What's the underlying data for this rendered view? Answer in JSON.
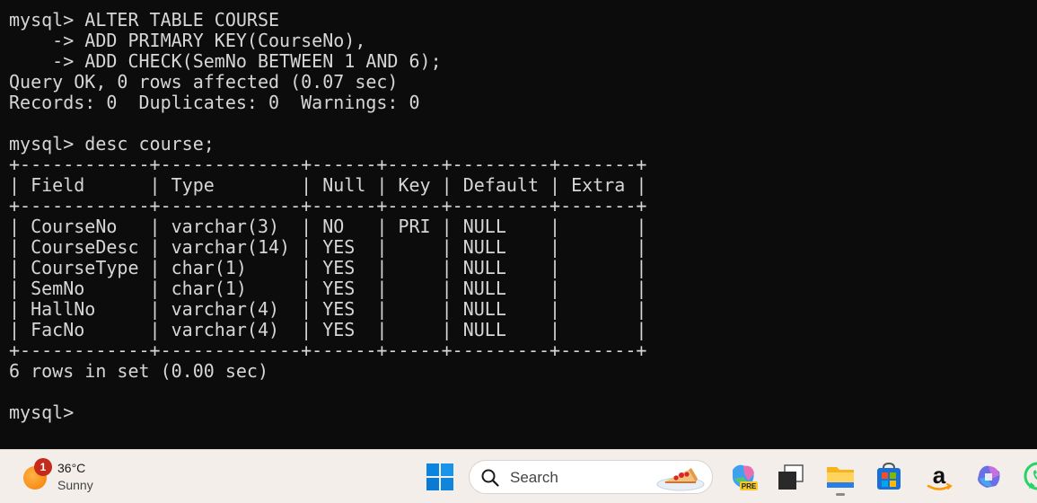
{
  "terminal": {
    "lines": [
      "mysql> ALTER TABLE COURSE",
      "    -> ADD PRIMARY KEY(CourseNo),",
      "    -> ADD CHECK(SemNo BETWEEN 1 AND 6);",
      "Query OK, 0 rows affected (0.07 sec)",
      "Records: 0  Duplicates: 0  Warnings: 0",
      "",
      "mysql> desc course;",
      "+------------+-------------+------+-----+---------+-------+",
      "| Field      | Type        | Null | Key | Default | Extra |",
      "+------------+-------------+------+-----+---------+-------+",
      "| CourseNo   | varchar(3)  | NO   | PRI | NULL    |       |",
      "| CourseDesc | varchar(14) | YES  |     | NULL    |       |",
      "| CourseType | char(1)     | YES  |     | NULL    |       |",
      "| SemNo      | char(1)     | YES  |     | NULL    |       |",
      "| HallNo     | varchar(4)  | YES  |     | NULL    |       |",
      "| FacNo      | varchar(4)  | YES  |     | NULL    |       |",
      "+------------+-------------+------+-----+---------+-------+",
      "6 rows in set (0.00 sec)",
      "",
      "mysql>"
    ]
  },
  "taskbar": {
    "weather": {
      "badge": "1",
      "temperature": "36°C",
      "condition": "Sunny",
      "icon": "weather-sun-icon"
    },
    "start_icon": "windows-start-icon",
    "search": {
      "placeholder": "Search"
    },
    "apps": [
      {
        "name": "copilot-pre-icon",
        "label": "PRE"
      },
      {
        "name": "task-view-icon"
      },
      {
        "name": "file-explorer-icon"
      },
      {
        "name": "microsoft-store-icon"
      },
      {
        "name": "amazon-icon"
      },
      {
        "name": "copilot-icon"
      },
      {
        "name": "whatsapp-icon"
      }
    ]
  },
  "colors": {
    "terminal_bg": "#0c0c0c",
    "terminal_fg": "#d6d6d6",
    "taskbar_bg": "#f3eee9",
    "badge": "#c42b1c",
    "accent": "#0078d4"
  }
}
